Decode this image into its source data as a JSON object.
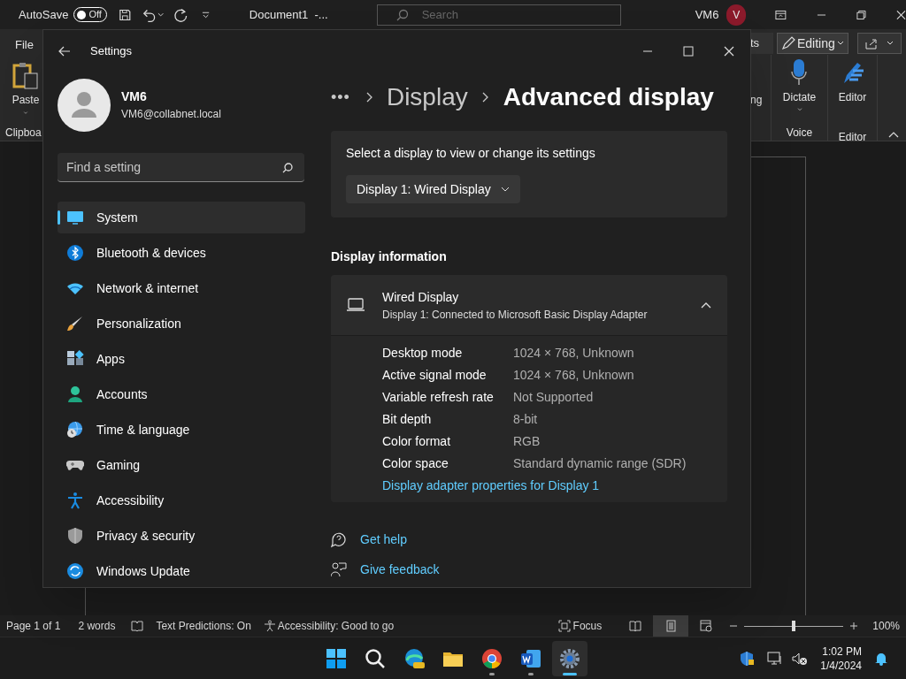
{
  "word": {
    "autosave": {
      "label": "AutoSave",
      "toggle_text": "Off",
      "on": false
    },
    "document_title": "Document1  -...",
    "search": {
      "placeholder": "Search"
    },
    "user": "VM6",
    "avatar": "V",
    "ribbon_left": {
      "tab": "File",
      "paste": "Paste",
      "group": "Clipboa"
    },
    "ribbon_right": {
      "cut_tab": "ts",
      "editing": "Editing",
      "cut_label": "ng",
      "dictate": "Dictate",
      "voice_group": "Voice",
      "editor": "Editor",
      "editor_group": "Editor"
    },
    "status_bar": {
      "page": "Page 1 of 1",
      "words": "2 words",
      "predictions": "Text Predictions: On",
      "accessibility": "Accessibility: Good to go",
      "focus": "Focus",
      "views": [
        {
          "selected": false
        },
        {
          "selected": true
        },
        {
          "selected": false
        }
      ],
      "zoom_slider": {
        "level": 0.5
      },
      "zoom": "100%"
    }
  },
  "settings": {
    "window": {
      "title": "Settings"
    },
    "user": {
      "name": "VM6",
      "email": "VM6@collabnet.local"
    },
    "search": {
      "placeholder": "Find a setting"
    },
    "sidebar": {
      "items": [
        {
          "label": "System",
          "selected": true
        },
        {
          "label": "Bluetooth & devices",
          "selected": false
        },
        {
          "label": "Network & internet",
          "selected": false
        },
        {
          "label": "Personalization",
          "selected": false
        },
        {
          "label": "Apps",
          "selected": false
        },
        {
          "label": "Accounts",
          "selected": false
        },
        {
          "label": "Time & language",
          "selected": false
        },
        {
          "label": "Gaming",
          "selected": false
        },
        {
          "label": "Accessibility",
          "selected": false
        },
        {
          "label": "Privacy & security",
          "selected": false
        },
        {
          "label": "Windows Update",
          "selected": false
        }
      ]
    },
    "breadcrumb": {
      "more": "•••",
      "parent": "Display",
      "current": "Advanced display"
    },
    "select_card": {
      "text": "Select a display to view or change its settings",
      "dropdown": "Display 1: Wired Display"
    },
    "section_title": "Display information",
    "expander": {
      "title": "Wired Display",
      "subtitle": "Display 1: Connected to Microsoft Basic Display Adapter",
      "expanded": true,
      "rows": [
        {
          "label": "Desktop mode",
          "value": "1024 × 768, Unknown"
        },
        {
          "label": "Active signal mode",
          "value": "1024 × 768, Unknown"
        },
        {
          "label": "Variable refresh rate",
          "value": "Not Supported"
        },
        {
          "label": "Bit depth",
          "value": "8-bit"
        },
        {
          "label": "Color format",
          "value": "RGB"
        },
        {
          "label": "Color space",
          "value": "Standard dynamic range (SDR)"
        }
      ],
      "link": "Display adapter properties for Display 1"
    },
    "help_links": [
      "Get help",
      "Give feedback"
    ]
  },
  "taskbar": {
    "apps": [
      {
        "kind": "start",
        "running": false,
        "selected": false
      },
      {
        "kind": "search",
        "running": false,
        "selected": false
      },
      {
        "kind": "edge",
        "running": false,
        "selected": false
      },
      {
        "kind": "files",
        "running": false,
        "selected": false
      },
      {
        "kind": "chrome",
        "running": true,
        "selected": false
      },
      {
        "kind": "word",
        "running": true,
        "selected": false
      },
      {
        "kind": "settings",
        "running": true,
        "selected": true
      }
    ],
    "time": "1:02 PM",
    "date": "1/4/2024"
  }
}
